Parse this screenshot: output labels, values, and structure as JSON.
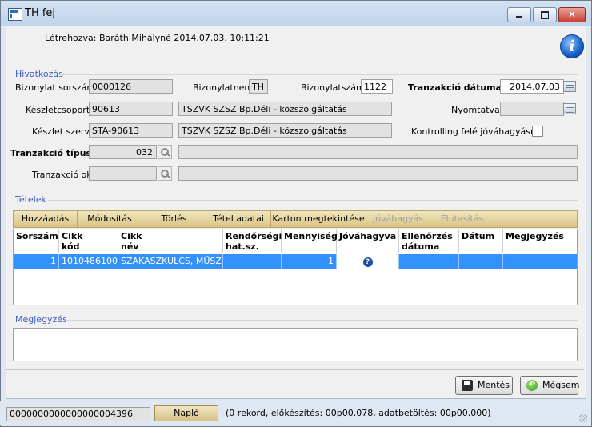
{
  "window": {
    "title": "TH fej"
  },
  "created": "Létrehozva: Baráth Mihályné 2014.07.03.  10:11:21",
  "section_reference": "Hivatkozás",
  "labels": {
    "doc_serial": "Bizonylat sorszám:",
    "doc_type": "Bizonylatnem:",
    "doc_number": "Bizonylatszám:",
    "trx_date": "Tranzakció dátuma:",
    "stock_group": "Készletcsoport:",
    "printed": "Nyomtatva:",
    "stock_org": "Készlet szerv:",
    "controlling": "Kontrolling felé jóváhagyásra",
    "trx_type": "Tranzakció típus:",
    "trx_reason": "Tranzakció ok:"
  },
  "values": {
    "doc_serial": "0000126",
    "doc_type": "TH",
    "doc_number": "1122",
    "trx_date": "2014.07.03",
    "printed": "",
    "stock_group_code": "90613",
    "stock_group_name": "TSZVK SZSZ Bp.Déli - közszolgáltatás",
    "stock_org_code": "STA-90613",
    "stock_org_name": "TSZVK SZSZ Bp.Déli - közszolgáltatás",
    "trx_type": "032",
    "trx_type_desc": "",
    "trx_reason": "",
    "trx_reason_desc": ""
  },
  "section_items": "Tételek",
  "toolbar": {
    "add": "Hozzáadás",
    "edit": "Módosítás",
    "delete": "Törlés",
    "item_data": "Tétel adatai",
    "card_view": "Karton megtekintése",
    "approve": "Jóváhagyás",
    "reject": "Elutasítás"
  },
  "grid": {
    "headers": {
      "sorszam": "Sorszám",
      "cikk_kod": "Cikk\nkód",
      "cikk_nev": "Cikk\nnév",
      "rendorsegi": "Rendőrségi\nhat.sz.",
      "mennyiseg": "Mennyiség",
      "jovahagyva": "Jóváhagyva",
      "ellenorzes": "Ellenőrzés\ndátuma",
      "datum": "Dátum",
      "megjegyzes": "Megjegyzés"
    },
    "rows": [
      {
        "sorszam": "1",
        "cikk_kod": "1010486100",
        "cikk_nev": "SZAKASZKULCS, MŰSZAKI",
        "rendorsegi": "",
        "mennyiseg": "1",
        "jovahagyva": "?",
        "ellenorzes": "",
        "datum": "",
        "megjegyzes": ""
      }
    ]
  },
  "section_notes": "Megjegyzés",
  "notes_value": "",
  "buttons": {
    "save": "Mentés",
    "cancel": "Mégsem"
  },
  "statusbar": {
    "id": "0000000000000000004396",
    "log": "Napló",
    "info": "(0 rekord, előkészítés: 00p00.078, adatbetöltés: 00p00.000)"
  },
  "colors": {
    "selection": "#3390ff",
    "group_title": "#3a5fc0",
    "toolbar": "#e3d49c"
  },
  "icons": [
    "app-icon",
    "minimize-icon",
    "maximize-icon",
    "close-icon",
    "info-icon",
    "calendar-icon",
    "lookup-key-icon",
    "question-icon",
    "save-icon",
    "cancel-icon"
  ]
}
